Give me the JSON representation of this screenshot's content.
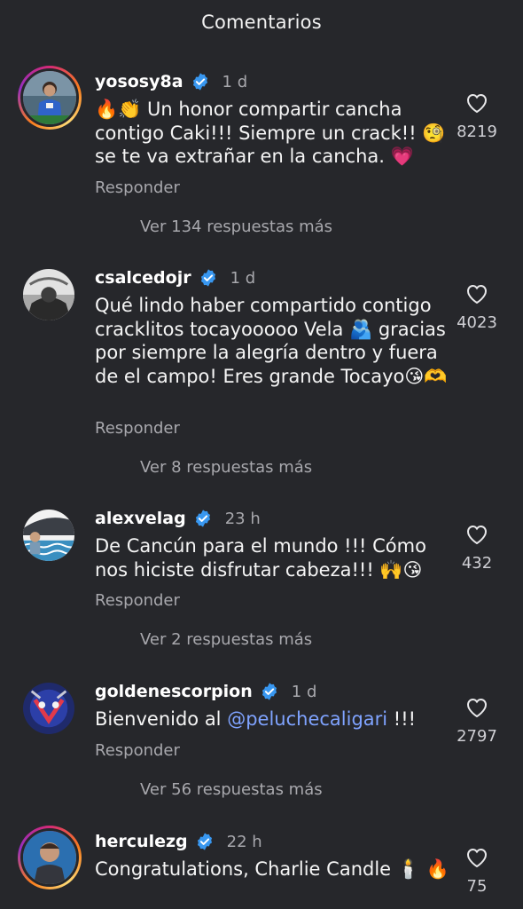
{
  "header": {
    "title": "Comentarios"
  },
  "comments": [
    {
      "username": "yososy8a",
      "time": "1 d",
      "text": "🔥👏 Un honor compartir cancha contigo Caki!!! Siempre un crack!! 🧐 se te va extrañar en la cancha. 💗",
      "reply": "Responder",
      "likes": "8219",
      "view_more": "Ver 134 respuestas más"
    },
    {
      "username": "csalcedojr",
      "time": "1 d",
      "text": "Qué lindo haber compartido contigo cracklitos tocayooooo Vela 🫂 gracias por siempre la alegría dentro y fuera de el campo!  Eres grande Tocayo😘🫶",
      "reply": "Responder",
      "likes": "4023",
      "view_more": "Ver 8 respuestas más"
    },
    {
      "username": "alexvelag",
      "time": "23 h",
      "text": "De Cancún para el mundo !!! Cómo nos hiciste disfrutar cabeza!!! 🙌😘",
      "reply": "Responder",
      "likes": "432",
      "view_more": "Ver 2 respuestas más"
    },
    {
      "username": "goldenescorpion",
      "time": "1 d",
      "text_prefix": "Bienvenido al ",
      "mention": "@peluchecaligari",
      "text_suffix": " !!!",
      "reply": "Responder",
      "likes": "2797",
      "view_more": "Ver 56 respuestas más"
    },
    {
      "username": "herculezg",
      "time": "22 h",
      "text": "Congratulations, Charlie Candle 🕯️ 🔥",
      "likes": "75"
    }
  ],
  "icons": {
    "verified_color": "#3897f0",
    "heart": "heart-outline-icon"
  }
}
